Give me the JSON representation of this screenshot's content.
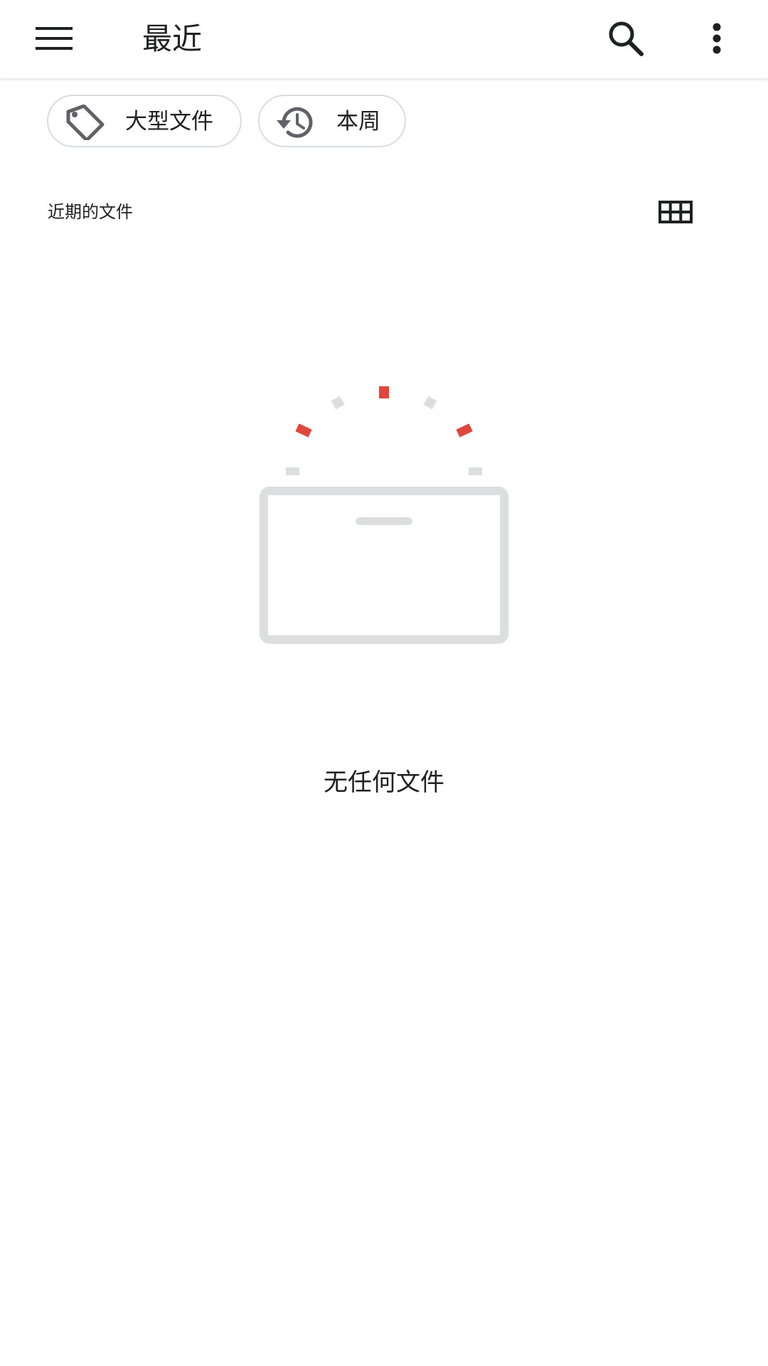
{
  "app_bar": {
    "title": "最近",
    "icons": {
      "menu": "menu-icon",
      "search": "search-icon",
      "more": "more-vert-icon"
    }
  },
  "chips": [
    {
      "label": "大型文件",
      "icon": "tag-icon"
    },
    {
      "label": "本周",
      "icon": "history-icon"
    }
  ],
  "section": {
    "label": "近期的文件",
    "view_toggle_icon": "grid-view-icon"
  },
  "empty_state": {
    "illustration_icon": "empty-box-icon",
    "message": "无任何文件"
  },
  "colors": {
    "text_primary": "#202124",
    "icon_gray": "#5f6368",
    "chip_border": "#dadce0",
    "illustration_gray": "#dcdee0",
    "accent_red": "#e0463b"
  }
}
